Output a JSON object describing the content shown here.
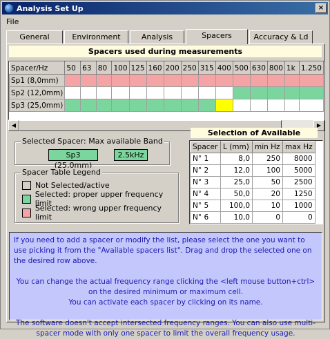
{
  "window": {
    "title": "Analysis Set Up",
    "close": "×"
  },
  "menu": [
    "File"
  ],
  "tabs": [
    "General",
    "Environment",
    "Analysis",
    "Spacers",
    "Accuracy & Ld"
  ],
  "active_tab": "Spacers",
  "spacer_grid": {
    "title": "Spacers used during measurements",
    "header": [
      "Spacer/Hz",
      "50",
      "63",
      "80",
      "100",
      "125",
      "160",
      "200",
      "250",
      "315",
      "400",
      "500",
      "630",
      "800",
      "1k",
      "1.250"
    ],
    "rows": [
      {
        "name": "Sp1 (8,0mm)",
        "name_color": "red",
        "cells": [
          "red",
          "red",
          "red",
          "red",
          "red",
          "red",
          "red",
          "red",
          "red",
          "red",
          "red",
          "red",
          "red",
          "red",
          "red"
        ]
      },
      {
        "name": "Sp2 (12,0mm)",
        "name_color": "green",
        "cells": [
          "white",
          "white",
          "white",
          "white",
          "white",
          "white",
          "white",
          "white",
          "white",
          "white",
          "green",
          "green",
          "green",
          "green",
          "green"
        ]
      },
      {
        "name": "Sp3 (25,0mm)",
        "name_color": "green",
        "cells": [
          "green",
          "green",
          "green",
          "green",
          "green",
          "green",
          "green",
          "green",
          "green",
          "yellow",
          "white",
          "white",
          "white",
          "white",
          "white"
        ]
      }
    ]
  },
  "selected_spacer": {
    "label": "Selected Spacer: Max available Band",
    "spacer": "Sp3 (25,0mm)",
    "band": "2.5kHz"
  },
  "legend": {
    "label": "Spacer Table  Legend",
    "items": [
      {
        "color": "#d4d0c8",
        "text": "Not Selected/active"
      },
      {
        "color": "#7ad69d",
        "text": "Selected:  proper upper frequency limit"
      },
      {
        "color": "#f4a4a4",
        "text": "Selected:  wrong upper frequency limit"
      }
    ]
  },
  "available": {
    "title": "Selection of Available Spacers",
    "columns": [
      "Spacer",
      "L (mm)",
      "min Hz",
      "max Hz"
    ],
    "rows": [
      [
        "N° 1",
        "8,0",
        "250",
        "8000"
      ],
      [
        "N° 2",
        "12,0",
        "100",
        "5000"
      ],
      [
        "N° 3",
        "25,0",
        "50",
        "2500"
      ],
      [
        "N° 4",
        "50,0",
        "20",
        "1250"
      ],
      [
        "N° 5",
        "100,0",
        "10",
        "1000"
      ],
      [
        "N° 6",
        "10,0",
        "0",
        "0"
      ]
    ]
  },
  "info": {
    "p1": "If you need to add a spacer or modify the list, please select the one you want to use picking it from the \"Available spacers list\". Drag and drop the selected one on the desired row above.",
    "p2": "You can change the actual frequency range clicking the <left mouse button+ctrl> on the desired minimum or maximum cell.",
    "p3": "You can activate each spacer by clicking on its name.",
    "p4": "The software doesn't accept intersected frequency ranges. You can also use multi-spacer mode with only one spacer to limit the overall frequency usage."
  },
  "colors": {
    "red": "#f4a4a4",
    "green": "#7ad69d",
    "yellow": "#ffff00",
    "white": "#ffffff",
    "title_bar": "#0a246a",
    "info_bg": "#c4c7fb",
    "info_text": "#1a1ab0"
  }
}
